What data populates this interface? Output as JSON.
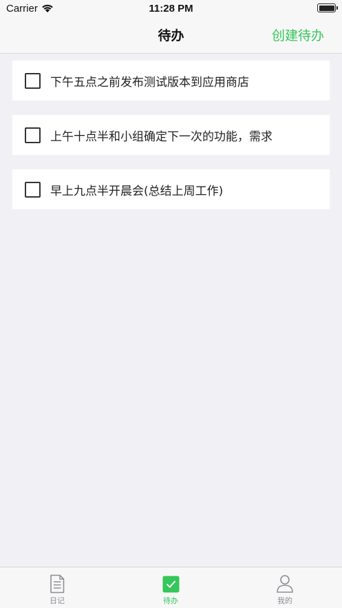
{
  "status_bar": {
    "carrier": "Carrier",
    "time": "11:28 PM"
  },
  "nav": {
    "title": "待办",
    "action_label": "创建待办"
  },
  "todos": [
    {
      "text": "下午五点之前发布测试版本到应用商店",
      "checked": false
    },
    {
      "text": "上午十点半和小组确定下一次的功能，需求",
      "checked": false
    },
    {
      "text": "早上九点半开晨会(总结上周工作)",
      "checked": false
    }
  ],
  "tabs": [
    {
      "label": "日记",
      "icon": "document-icon",
      "active": false
    },
    {
      "label": "待办",
      "icon": "checkbox-icon",
      "active": true
    },
    {
      "label": "我的",
      "icon": "person-icon",
      "active": false
    }
  ],
  "colors": {
    "accent": "#34c759",
    "background": "#f1f1f5",
    "inactive": "#8e8e93"
  }
}
